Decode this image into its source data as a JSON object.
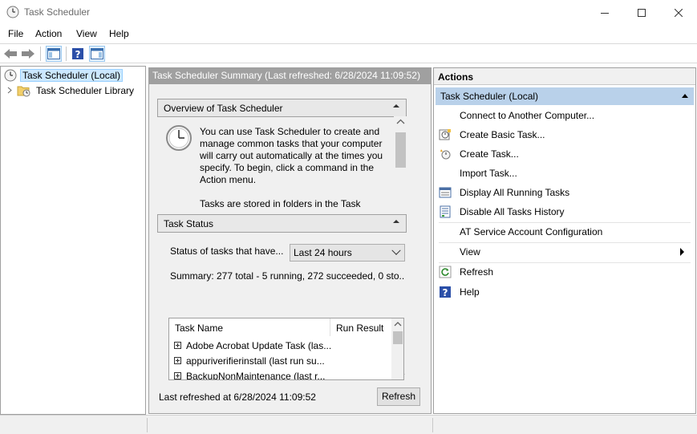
{
  "window": {
    "title": "Task Scheduler"
  },
  "menu": [
    "File",
    "Action",
    "View",
    "Help"
  ],
  "tree": {
    "root": "Task Scheduler (Local)",
    "library": "Task Scheduler Library"
  },
  "center": {
    "header": "Task Scheduler Summary (Last refreshed: 6/28/2024 11:09:52)",
    "overview": {
      "title": "Overview of Task Scheduler",
      "text": "You can use Task Scheduler to create and manage common tasks that your computer will carry out automatically at the times you specify. To begin, click a command in the Action menu.",
      "text2": "Tasks are stored in folders in the Task"
    },
    "task_status": {
      "title": "Task Status",
      "status_label": "Status of tasks that have...",
      "status_value": "Last 24 hours",
      "summary": "Summary: 277 total - 5 running, 272 succeeded, 0 sto...",
      "columns": [
        "Task Name",
        "Run Result"
      ],
      "rows": [
        "Adobe Acrobat Update Task (las...",
        "appuriverifierinstall (last run su...",
        "BackupNonMaintenance (last r..."
      ]
    },
    "last_refreshed": "Last refreshed at 6/28/2024 11:09:52",
    "refresh_button": "Refresh"
  },
  "actions": {
    "header": "Actions",
    "group": "Task Scheduler (Local)",
    "items": [
      "Connect to Another Computer...",
      "Create Basic Task...",
      "Create Task...",
      "Import Task...",
      "Display All Running Tasks",
      "Disable All Tasks History",
      "AT Service Account Configuration",
      "View",
      "Refresh",
      "Help"
    ]
  },
  "colors": {
    "selection": "#cce8ff",
    "group_header": "#b9d1ea",
    "pane_header": "#a0a0a0"
  }
}
